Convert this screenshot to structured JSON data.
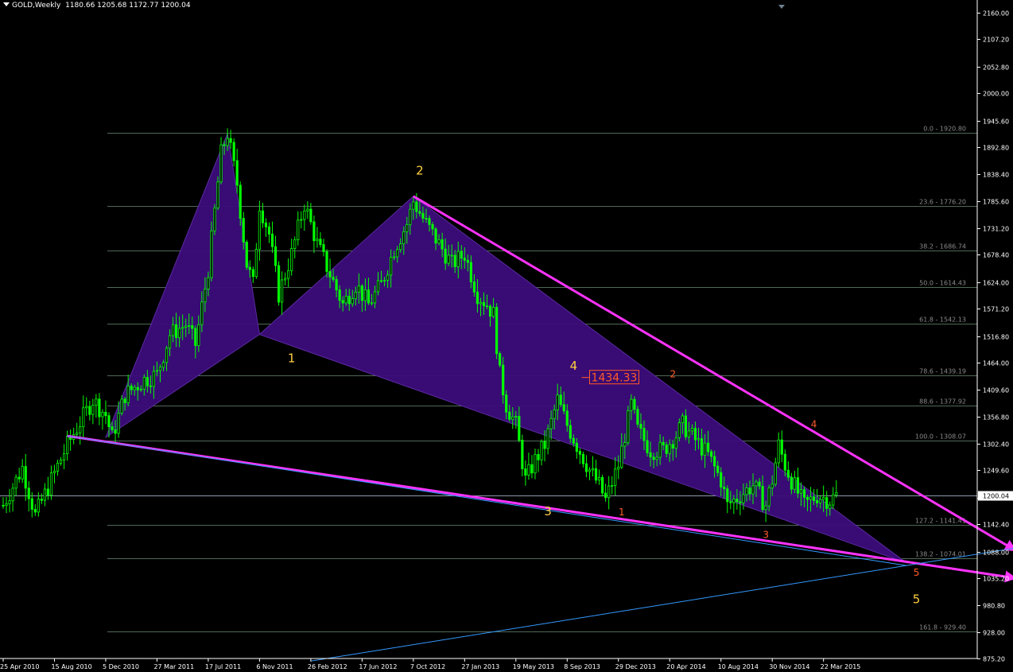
{
  "header": {
    "symbol": "GOLD,Weekly",
    "ohlc": "1180.66 1205.68 1172.77 1200.04"
  },
  "colors": {
    "background": "#000000",
    "candle": "#00ff00",
    "pattern_fill": "#3c0c7a",
    "trendline": "#ff33ff",
    "long_line": "#3399ff",
    "fib_line": "#506858",
    "axis_text": "#ffffff",
    "wave_yellow": "#ffd040",
    "wave_orange": "#ff5a28"
  },
  "chart_data": {
    "type": "candlestick",
    "symbol": "GOLD",
    "timeframe": "Weekly",
    "ylim": [
      875.2,
      2176.0
    ],
    "current_price": "1200.04",
    "y_ticks": [
      "2160.00",
      "2107.20",
      "2052.80",
      "2000.00",
      "1945.60",
      "1892.80",
      "1838.40",
      "1785.60",
      "1731.20",
      "1678.40",
      "1624.00",
      "1571.20",
      "1516.80",
      "1464.00",
      "1409.60",
      "1356.80",
      "1302.40",
      "1249.60",
      "1195.20",
      "1142.40",
      "1088.00",
      "1035.20",
      "980.80",
      "928.00",
      "875.20"
    ],
    "x_ticks": [
      {
        "label": "25 Apr 2010",
        "t": 0
      },
      {
        "label": "15 Aug 2010",
        "t": 16
      },
      {
        "label": "5 Dec 2010",
        "t": 32
      },
      {
        "label": "27 Mar 2011",
        "t": 48
      },
      {
        "label": "17 Jul 2011",
        "t": 64
      },
      {
        "label": "6 Nov 2011",
        "t": 80
      },
      {
        "label": "26 Feb 2012",
        "t": 96
      },
      {
        "label": "17 Jun 2012",
        "t": 112
      },
      {
        "label": "7 Oct 2012",
        "t": 128
      },
      {
        "label": "27 Jan 2013",
        "t": 144
      },
      {
        "label": "19 May 2013",
        "t": 160
      },
      {
        "label": "8 Sep 2013",
        "t": 176
      },
      {
        "label": "29 Dec 2013",
        "t": 192
      },
      {
        "label": "20 Apr 2014",
        "t": 208
      },
      {
        "label": "10 Aug 2014",
        "t": 224
      },
      {
        "label": "30 Nov 2014",
        "t": 240
      },
      {
        "label": "22 Mar 2015",
        "t": 256
      }
    ],
    "price_path": [
      [
        0,
        1180
      ],
      [
        6,
        1255
      ],
      [
        10,
        1160
      ],
      [
        20,
        1300
      ],
      [
        28,
        1390
      ],
      [
        32,
        1360
      ],
      [
        34,
        1315
      ],
      [
        38,
        1400
      ],
      [
        44,
        1430
      ],
      [
        48,
        1440
      ],
      [
        52,
        1520
      ],
      [
        57,
        1540
      ],
      [
        60,
        1500
      ],
      [
        64,
        1650
      ],
      [
        68,
        1880
      ],
      [
        70,
        1920
      ],
      [
        73,
        1820
      ],
      [
        76,
        1660
      ],
      [
        78,
        1620
      ],
      [
        80,
        1780
      ],
      [
        83,
        1720
      ],
      [
        86,
        1600
      ],
      [
        90,
        1680
      ],
      [
        94,
        1780
      ],
      [
        98,
        1700
      ],
      [
        102,
        1640
      ],
      [
        106,
        1580
      ],
      [
        110,
        1620
      ],
      [
        114,
        1580
      ],
      [
        118,
        1620
      ],
      [
        122,
        1690
      ],
      [
        126,
        1740
      ],
      [
        128,
        1785
      ],
      [
        132,
        1740
      ],
      [
        136,
        1700
      ],
      [
        140,
        1660
      ],
      [
        144,
        1680
      ],
      [
        148,
        1600
      ],
      [
        151,
        1580
      ],
      [
        153,
        1560
      ],
      [
        155,
        1440
      ],
      [
        157,
        1380
      ],
      [
        160,
        1340
      ],
      [
        163,
        1230
      ],
      [
        166,
        1270
      ],
      [
        169,
        1300
      ],
      [
        173,
        1390
      ],
      [
        176,
        1340
      ],
      [
        179,
        1300
      ],
      [
        183,
        1250
      ],
      [
        186,
        1220
      ],
      [
        188,
        1190
      ],
      [
        192,
        1260
      ],
      [
        196,
        1380
      ],
      [
        198,
        1330
      ],
      [
        202,
        1290
      ],
      [
        206,
        1290
      ],
      [
        210,
        1320
      ],
      [
        212,
        1340
      ],
      [
        216,
        1310
      ],
      [
        220,
        1280
      ],
      [
        224,
        1230
      ],
      [
        226,
        1180
      ],
      [
        230,
        1200
      ],
      [
        234,
        1220
      ],
      [
        238,
        1180
      ],
      [
        240,
        1230
      ],
      [
        242,
        1300
      ],
      [
        244,
        1260
      ],
      [
        246,
        1230
      ],
      [
        250,
        1180
      ],
      [
        254,
        1200
      ],
      [
        258,
        1190
      ],
      [
        260,
        1200
      ]
    ],
    "fib_levels": [
      {
        "label": "0.0 - 1920.80",
        "price": 1920.8
      },
      {
        "label": "23.6 - 1776.20",
        "price": 1776.2
      },
      {
        "label": "38.2 - 1686.74",
        "price": 1686.74
      },
      {
        "label": "50.0 - 1614.43",
        "price": 1614.43
      },
      {
        "label": "61.8 - 1542.13",
        "price": 1542.13
      },
      {
        "label": "78.6 - 1439.19",
        "price": 1439.19
      },
      {
        "label": "88.6 - 1377.92",
        "price": 1377.92
      },
      {
        "label": "100.0 - 1308.07",
        "price": 1308.07
      },
      {
        "label": "127.2 - 1141.41",
        "price": 1141.41
      },
      {
        "label": "138.2 - 1074.01",
        "price": 1074.01
      },
      {
        "label": "161.8 - 929.40",
        "price": 929.4
      }
    ],
    "fib_start_t": 32,
    "pattern_points": {
      "X": [
        32,
        1315
      ],
      "A": [
        70,
        1920
      ],
      "B": [
        80,
        1520
      ],
      "C": [
        128,
        1795
      ],
      "D": [
        282,
        1065
      ]
    },
    "trendlines": [
      {
        "name": "upper",
        "from": [
          128,
          1795
        ],
        "to": [
          316,
          1090
        ],
        "color": "trendline",
        "arrow": true
      },
      {
        "name": "lower",
        "from": [
          20,
          1318
        ],
        "to": [
          316,
          1035
        ],
        "color": "trendline",
        "arrow": true
      },
      {
        "name": "long",
        "from": [
          20,
          1318
        ],
        "to": [
          282,
          1060
        ],
        "color": "long_line",
        "arrow": false
      },
      {
        "name": "rising",
        "from": [
          96,
          870
        ],
        "to": [
          316,
          1095
        ],
        "color": "long_line",
        "arrow": false
      }
    ],
    "price_label": {
      "text": "1434.33",
      "t": 183,
      "price": 1434.33
    },
    "wave_labels": [
      {
        "text": "2",
        "t": 130,
        "price": 1838,
        "color": "wave_yellow"
      },
      {
        "text": "1",
        "t": 90,
        "price": 1465,
        "color": "wave_yellow"
      },
      {
        "text": "4",
        "t": 178,
        "price": 1450,
        "color": "wave_yellow"
      },
      {
        "text": "3",
        "t": 170,
        "price": 1160,
        "color": "wave_yellow"
      },
      {
        "text": "2",
        "t": 209,
        "price": 1435,
        "color": "wave_orange"
      },
      {
        "text": "1",
        "t": 193,
        "price": 1160,
        "color": "wave_orange"
      },
      {
        "text": "4",
        "t": 253,
        "price": 1335,
        "color": "wave_orange"
      },
      {
        "text": "3",
        "t": 238,
        "price": 1115,
        "color": "wave_orange"
      },
      {
        "text": "5",
        "t": 285,
        "price": 1040,
        "color": "wave_orange"
      },
      {
        "text": "5",
        "t": 285,
        "price": 985,
        "color": "wave_yellow"
      }
    ]
  }
}
